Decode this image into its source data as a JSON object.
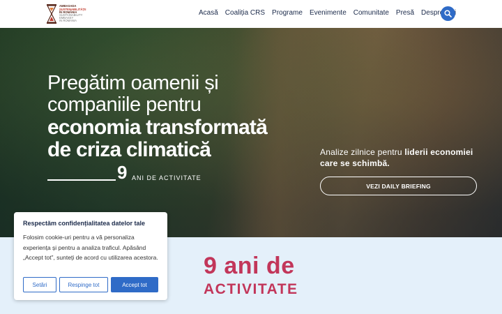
{
  "logo": {
    "line1": "AMBASADA",
    "line2": "SUSTENABILITĂȚII",
    "line3": "ÎN ROMÂNIA",
    "line4": "SUSTAINABILITY",
    "line5": "EMBASSY",
    "line6": "IN ROMANIA"
  },
  "nav": {
    "items": [
      "Acasă",
      "Coaliția CRS",
      "Programe",
      "Evenimente",
      "Comunitate",
      "Presă",
      "Despre Noi"
    ]
  },
  "hero": {
    "title_light_1": "Pregătim oamenii și",
    "title_light_2": "companiile pentru",
    "title_bold_1": "economia transformată",
    "title_bold_2": "de criza climatică",
    "years_number": "9",
    "years_text": "ANI DE ACTIVITATE",
    "analize_prefix": "Analize zilnice pentru ",
    "analize_bold": "liderii economiei care se schimbă.",
    "briefing_label": "VEZI DAILY BRIEFING"
  },
  "section": {
    "big_years": "9 ani de",
    "big_activity": "ACTIVITATE"
  },
  "cookie": {
    "title": "Respectăm confidențialitatea datelor tale",
    "text": "Folosim cookie-uri pentru a vă personaliza experiența și pentru a analiza traficul. Apăsând „Accept tot”, sunteți de acord cu utilizarea acestora.",
    "settings_label": "Setări",
    "reject_label": "Respinge tot",
    "accept_label": "Accept tot"
  },
  "colors": {
    "accent": "#2f6bc7",
    "brand_red": "#c2365a",
    "nav_text": "#1b2a4a",
    "section_bg": "#e4f0fa"
  },
  "icons": [
    "hourglass-logo-icon",
    "search-icon"
  ]
}
